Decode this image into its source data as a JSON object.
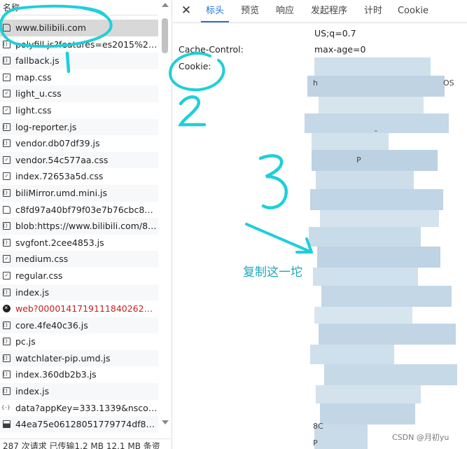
{
  "request_list": {
    "column_header": "名称",
    "items": [
      {
        "name": "www.bilibili.com",
        "type": "doc",
        "selected": true,
        "error": false
      },
      {
        "name": "polyfill.js?features=es2015%2Ce...",
        "type": "js",
        "selected": false,
        "error": false
      },
      {
        "name": "fallback.js",
        "type": "js",
        "selected": false,
        "error": false
      },
      {
        "name": "map.css",
        "type": "css",
        "selected": false,
        "error": false
      },
      {
        "name": "light_u.css",
        "type": "css",
        "selected": false,
        "error": false
      },
      {
        "name": "light.css",
        "type": "css",
        "selected": false,
        "error": false
      },
      {
        "name": "log-reporter.js",
        "type": "js",
        "selected": false,
        "error": false
      },
      {
        "name": "vendor.db07df39.js",
        "type": "js",
        "selected": false,
        "error": false
      },
      {
        "name": "vendor.54c577aa.css",
        "type": "css",
        "selected": false,
        "error": false
      },
      {
        "name": "index.72653a5d.css",
        "type": "css",
        "selected": false,
        "error": false
      },
      {
        "name": "biliMirror.umd.mini.js",
        "type": "js",
        "selected": false,
        "error": false
      },
      {
        "name": "c8fd97a40bf79f03e7b76cbc872...",
        "type": "doc",
        "selected": false,
        "error": false
      },
      {
        "name": "blob:https://www.bilibili.com/83...",
        "type": "js",
        "selected": false,
        "error": false
      },
      {
        "name": "svgfont.2cee4853.js",
        "type": "js",
        "selected": false,
        "error": false
      },
      {
        "name": "medium.css",
        "type": "css",
        "selected": false,
        "error": false
      },
      {
        "name": "regular.css",
        "type": "css",
        "selected": false,
        "error": false
      },
      {
        "name": "index.js",
        "type": "js",
        "selected": false,
        "error": false
      },
      {
        "name": "web?000014171911184026​2htt...",
        "type": "err",
        "selected": false,
        "error": true
      },
      {
        "name": "core.4fe40c36.js",
        "type": "js",
        "selected": false,
        "error": false
      },
      {
        "name": "pc.js",
        "type": "js",
        "selected": false,
        "error": false
      },
      {
        "name": "watchlater-pip.umd.js",
        "type": "js",
        "selected": false,
        "error": false
      },
      {
        "name": "index.360db2b3.js",
        "type": "js",
        "selected": false,
        "error": false
      },
      {
        "name": "index.js",
        "type": "js",
        "selected": false,
        "error": false
      },
      {
        "name": "data?appKey=333.1339&nscod...",
        "type": "data",
        "selected": false,
        "error": false
      },
      {
        "name": "44ea75e06128051779774df878f...",
        "type": "img",
        "selected": false,
        "error": false
      }
    ],
    "status_bar": "287 次请求  已传输1.2 MB  12.1 MB 条资"
  },
  "detail_panel": {
    "close_label": "✕",
    "tabs": [
      "标头",
      "预览",
      "响应",
      "发起程序",
      "计时",
      "Cookie"
    ],
    "active_tab": "标头",
    "headers": [
      {
        "name": "",
        "value": "US;q=0.7"
      },
      {
        "name": "Cache-Control:",
        "value": "max-age=0"
      },
      {
        "name": "Cookie:",
        "value": ""
      }
    ],
    "stray_fragments": [
      "h",
      "-",
      "P",
      "8C",
      "P",
      "OS"
    ]
  },
  "annotations": {
    "labels": [
      "1",
      "2",
      "3"
    ],
    "copy_hint": "复制这一坨",
    "color": "#1fa7b8"
  },
  "watermark": "CSDN @月初yu"
}
